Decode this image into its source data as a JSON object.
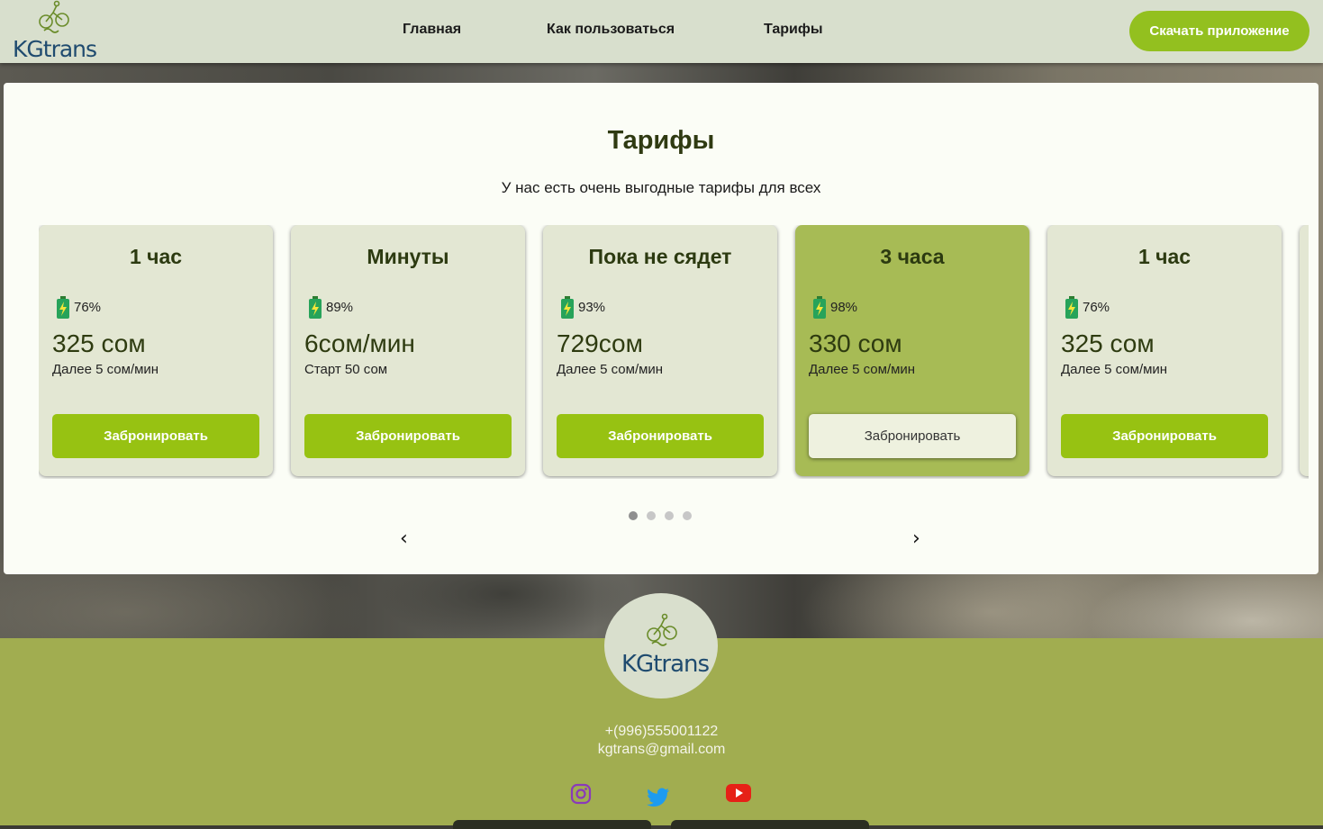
{
  "header": {
    "logo_text": "KGtrans",
    "nav": [
      {
        "label": "Главная"
      },
      {
        "label": "Как пользоваться"
      },
      {
        "label": "Тарифы"
      }
    ],
    "download_label": "Скачать приложение"
  },
  "tariffs": {
    "title": "Тарифы",
    "subtitle": "У нас есть очень выгодные тарифы для всех",
    "cards": [
      {
        "title": "1 час",
        "battery": "76%",
        "price": "325 сом",
        "note": "Далее 5 сом/мин",
        "button": "Забронировать",
        "active": false
      },
      {
        "title": "Минуты",
        "battery": "89%",
        "price": "6сом/мин",
        "note": "Старт 50 сом",
        "button": "Забронировать",
        "active": false
      },
      {
        "title": "Пока не сядет",
        "battery": "93%",
        "price": "729сом",
        "note": "Далее 5 сом/мин",
        "button": "Забронировать",
        "active": false
      },
      {
        "title": "3 часа",
        "battery": "98%",
        "price": "330 сом",
        "note": "Далее 5 сом/мин",
        "button": "Забронировать",
        "active": true
      },
      {
        "title": "1 час",
        "battery": "76%",
        "price": "325 сом",
        "note": "Далее 5 сом/мин",
        "button": "Забронировать",
        "active": false
      }
    ],
    "dots": {
      "count": 4,
      "active_index": 0
    },
    "prev_icon": "chevron-left-icon",
    "next_icon": "chevron-right-icon"
  },
  "footer": {
    "logo_text": "KGtrans",
    "phone": "+(996)555001122",
    "email": "kgtrans@gmail.com",
    "social": [
      {
        "icon": "instagram-icon",
        "color": "#8a3ab9"
      },
      {
        "icon": "twitter-icon",
        "color": "#1d9bf0"
      },
      {
        "icon": "youtube-icon",
        "color": "#e62117"
      }
    ]
  },
  "colors": {
    "accent_green": "#97c212",
    "header_bg": "#d8dfcd",
    "footer_bg": "#a1ad50",
    "active_card": "#a7bb55",
    "logo_blue": "#1f4b6f"
  }
}
